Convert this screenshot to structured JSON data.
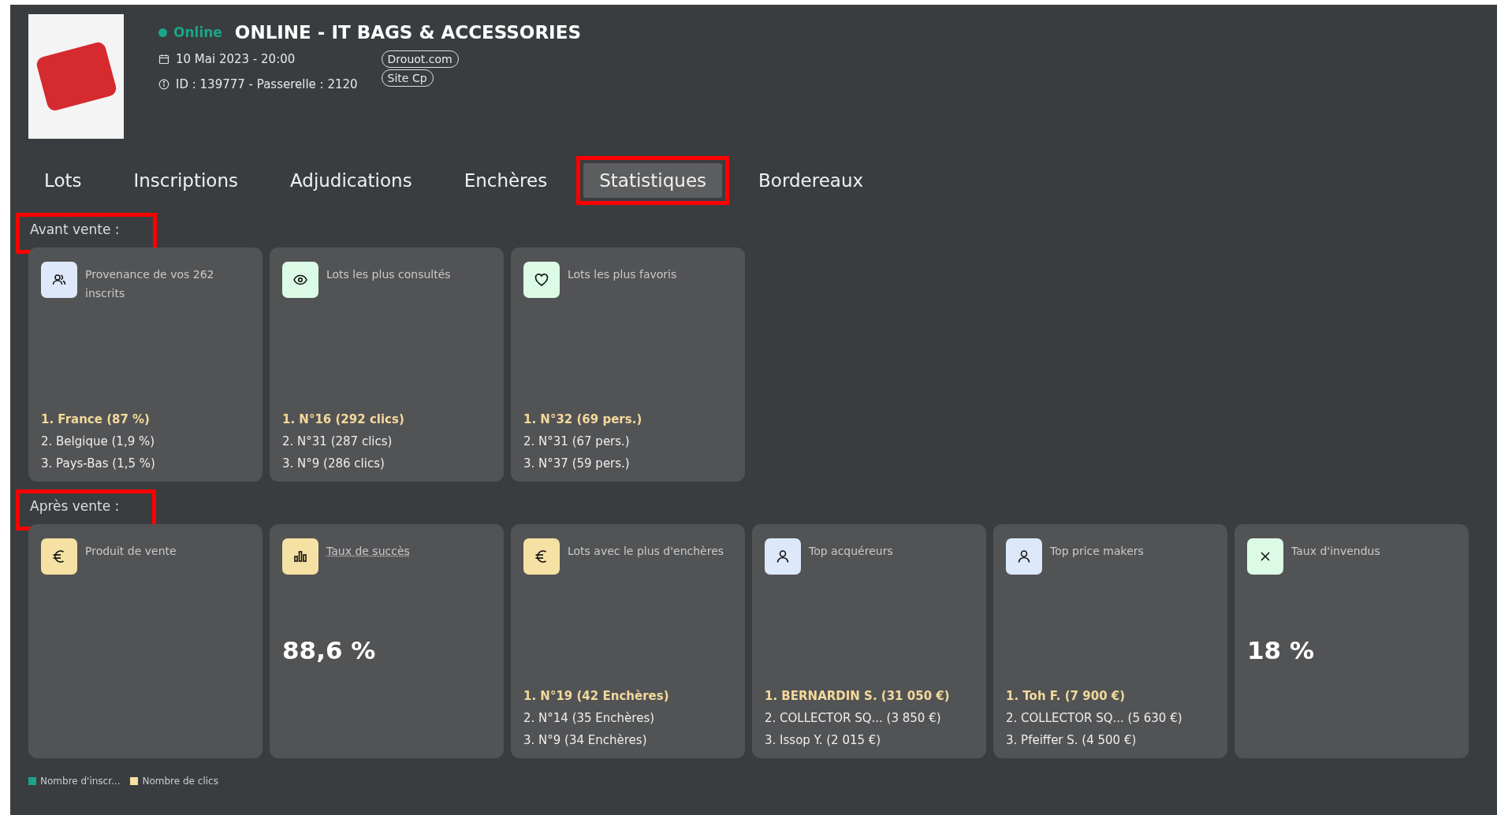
{
  "sale": {
    "status": "Online",
    "title": "ONLINE - IT BAGS & ACCESSORIES",
    "date": "10 Mai 2023 - 20:00",
    "id_line": "ID : 139777 - Passerelle : 2120",
    "tags": [
      "Drouot.com",
      "Site Cp"
    ]
  },
  "tabs": [
    {
      "label": "Lots",
      "selected": false,
      "highlighted": false
    },
    {
      "label": "Inscriptions",
      "selected": false,
      "highlighted": false
    },
    {
      "label": "Adjudications",
      "selected": false,
      "highlighted": false
    },
    {
      "label": "Enchères",
      "selected": false,
      "highlighted": false
    },
    {
      "label": "Statistiques",
      "selected": true,
      "highlighted": true
    },
    {
      "label": "Bordereaux",
      "selected": false,
      "highlighted": false
    }
  ],
  "sections": [
    {
      "heading": "Avant vente :",
      "highlighted": true,
      "cards": [
        {
          "kind": "list",
          "color": "#dde9fb",
          "title": "Provenance de vos 262 inscrits",
          "hint": false,
          "items": [
            "1. France (87 %)",
            "2. Belgique (1,9 %)",
            "3. Pays-Bas (1,5 %)"
          ]
        },
        {
          "kind": "list",
          "color": "#dcfbe6",
          "title": "Lots les plus consultés",
          "hint": false,
          "items": [
            "1. N°16 (292 clics)",
            "2. N°31 (287 clics)",
            "3. N°9 (286 clics)"
          ]
        },
        {
          "kind": "list",
          "color": "#dcfbe6",
          "title": "Lots les plus favoris",
          "hint": false,
          "items": [
            "1. N°32 (69 pers.)",
            "2. N°31 (67 pers.)",
            "3. N°37 (59 pers.)"
          ]
        }
      ]
    },
    {
      "heading": "Après vente :",
      "highlighted": true,
      "cards": [
        {
          "kind": "empty",
          "color": "#f5e1a4",
          "title": "Produit de vente",
          "hint": false
        },
        {
          "kind": "value",
          "color": "#f5e1a4",
          "title": "Taux de succès",
          "hint": true,
          "value": "88,6 %"
        },
        {
          "kind": "list",
          "color": "#f5e1a4",
          "title": "Lots avec le plus d'enchères",
          "hint": false,
          "items": [
            "1. N°19 (42 Enchères)",
            "2. N°14 (35 Enchères)",
            "3. N°9 (34 Enchères)"
          ]
        },
        {
          "kind": "list",
          "color": "#dde9fb",
          "title": "Top acquéreurs",
          "hint": false,
          "items": [
            "1. BERNARDIN S. (31 050 €)",
            "2. COLLECTOR SQ... (3 850 €)",
            "3. Issop Y. (2 015 €)"
          ]
        },
        {
          "kind": "list",
          "color": "#dde9fb",
          "title": "Top price makers",
          "hint": false,
          "items": [
            "1. Toh F. (7 900 €)",
            "2. COLLECTOR SQ... (5 630 €)",
            "3. Pfeiffer S. (4 500 €)"
          ]
        },
        {
          "kind": "value",
          "color": "#dcfbe6",
          "title": "Taux d'invendus",
          "hint": false,
          "value": "18 %"
        }
      ]
    }
  ],
  "legend": [
    {
      "label": "Nombre d'inscr...",
      "color": "#1aa58a"
    },
    {
      "label": "Nombre de clics",
      "color": "#f5e1a4"
    }
  ]
}
